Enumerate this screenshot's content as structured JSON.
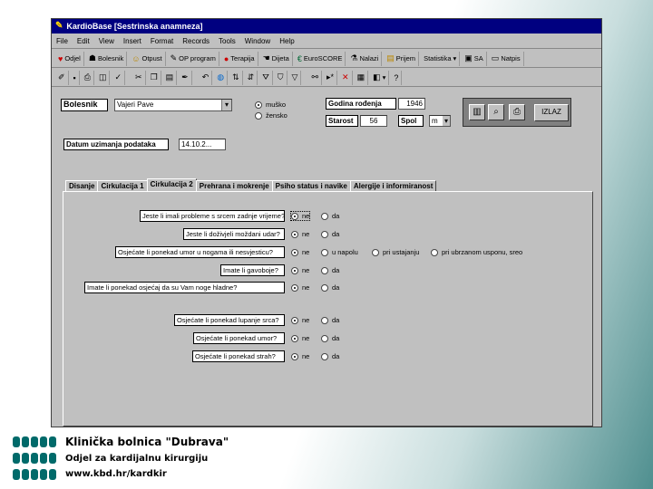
{
  "window": {
    "title": "KardioBase   [Sestrinska anamneza]"
  },
  "menu": [
    "File",
    "Edit",
    "View",
    "Insert",
    "Format",
    "Records",
    "Tools",
    "Window",
    "Help"
  ],
  "toolbar1": [
    {
      "icon": "heart-icon",
      "label": "Odjel"
    },
    {
      "icon": "person-icon",
      "label": "Bolesnik"
    },
    {
      "icon": "smile-icon",
      "label": "Otpust"
    },
    {
      "icon": "pen-icon",
      "label": "OP program"
    },
    {
      "icon": "pin-icon",
      "label": "Terapija"
    },
    {
      "icon": "hand-icon",
      "label": "Dijeta"
    },
    {
      "icon": "euroscore-icon",
      "label": "EuroSCORE"
    },
    {
      "icon": "flask-icon",
      "label": "Nalazi"
    },
    {
      "icon": "folder-icon",
      "label": "Prijem"
    },
    {
      "icon": "chart-icon",
      "label": "Statistika"
    },
    {
      "icon": "sa-icon",
      "label": "SA"
    },
    {
      "icon": "exit-icon",
      "label": "Natpis"
    }
  ],
  "patient": {
    "label": "Bolesnik",
    "name": "Vajeri Pave",
    "gender_options": [
      "muško",
      "žensko"
    ],
    "gender_selected": 0,
    "birth_year_label": "Godina rođenja",
    "birth_year": "1946",
    "age_label": "Starost",
    "age": "56",
    "sex_label": "Spol",
    "sex": "m",
    "date_label": "Datum uzimanja podataka",
    "date": "14.10.2...",
    "exit_label": "IZLAZ"
  },
  "tabs": [
    "Disanje",
    "Cirkulacija 1",
    "Cirkulacija 2",
    "Prehrana i mokrenje",
    "Psiho status i navike",
    "Alergije i informiranost"
  ],
  "active_tab": 2,
  "questions": [
    {
      "text": "Jeste li imali probleme s srcem zadnje vrijeme?",
      "options": [
        "ne",
        "da"
      ],
      "selected": 0
    },
    {
      "text": "Jeste li doživjeli moždani udar?",
      "options": [
        "ne",
        "da"
      ],
      "selected": 0
    },
    {
      "text": "Osjećate li ponekad umor u nogama ili nesvjesticu?",
      "options": [
        "ne",
        "u napolu",
        "pri ustajanju",
        "pri ubrzanom usponu, sreo"
      ],
      "selected": 0
    },
    {
      "text": "Imate li gavoboje?",
      "options": [
        "ne",
        "da"
      ],
      "selected": 0
    },
    {
      "text": "Imate li ponekad osjećaj da su Vam noge hladne?",
      "options": [
        "ne",
        "da"
      ],
      "selected": 0
    },
    {
      "text": "Osjećate li ponekad lupanje srca?",
      "options": [
        "ne",
        "da"
      ],
      "selected": 0
    },
    {
      "text": "Osjećate li ponekad umor?",
      "options": [
        "ne",
        "da"
      ],
      "selected": 0
    },
    {
      "text": "Osjećate li ponekad strah?",
      "options": [
        "ne",
        "da"
      ],
      "selected": 0
    }
  ],
  "footer": {
    "line1": "Klinička bolnica \"Dubrava\"",
    "line2": "Odjel za kardijalnu kirurgiju",
    "line3": "www.kbd.hr/kardkir"
  },
  "colors": {
    "titlebar": "#000080",
    "logo": "#006a6a",
    "window": "#c0c0c0"
  }
}
